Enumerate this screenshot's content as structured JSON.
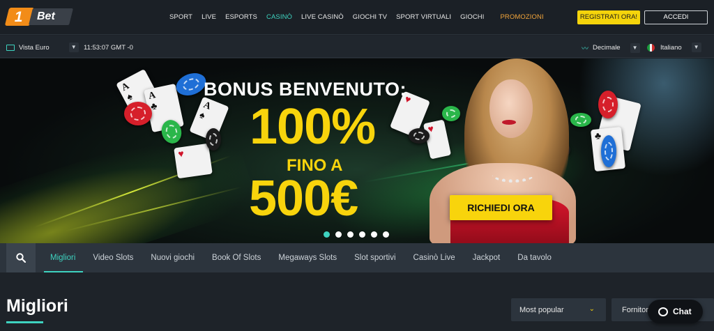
{
  "brand": {
    "logo_number": "1",
    "logo_text": "Bet"
  },
  "nav": {
    "items": [
      {
        "label": "SPORT"
      },
      {
        "label": "LIVE"
      },
      {
        "label": "ESPORTS"
      },
      {
        "label": "CASINÒ",
        "active": true
      },
      {
        "label": "LIVE CASINÒ"
      },
      {
        "label": "GIOCHI TV"
      },
      {
        "label": "SPORT VIRTUALI"
      },
      {
        "label": "GIOCHI"
      }
    ],
    "promo_label": "PROMOZIONI",
    "register_label": "REGISTRATI ORA!",
    "login_label": "ACCEDI"
  },
  "subbar": {
    "view_label": "Vista Euro",
    "clock": "11:53:07 GMT -0",
    "odds_format": "Decimale",
    "language": "Italiano"
  },
  "banner": {
    "line1": "BONUS BENVENUTO:",
    "line2": "100%",
    "line3": "FINO A",
    "line4": "500€",
    "cta_label": "RICHIEDI ORA",
    "slide_count": 6,
    "active_slide": 1
  },
  "categories": {
    "items": [
      "Migliori",
      "Video Slots",
      "Nuovi giochi",
      "Book Of Slots",
      "Megaways Slots",
      "Slot sportivi",
      "Casinò Live",
      "Jackpot",
      "Da tavolo"
    ],
    "active_index": 0
  },
  "section": {
    "title": "Migliori",
    "sort_label": "Most popular",
    "providers_label": "Fornitori"
  },
  "chat": {
    "label": "Chat"
  },
  "colors": {
    "accent": "#3ed3c0",
    "yellow": "#f8d40c",
    "brand_orange": "#f28c18",
    "promo": "#f2a43a"
  },
  "icons": [
    "monitor-icon",
    "chevron-down-icon",
    "trend-icon",
    "italy-flag-icon",
    "search-icon",
    "chat-bubble-icon"
  ]
}
